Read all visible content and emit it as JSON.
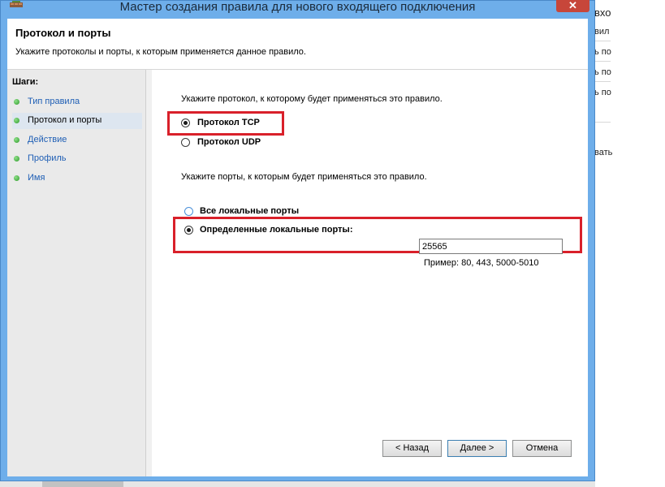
{
  "window": {
    "title": "Мастер создания правила для нового входящего подключения",
    "close_glyph": "✕"
  },
  "header": {
    "title": "Протокол и порты",
    "description": "Укажите протоколы и порты, к которым применяется данное правило."
  },
  "steps": {
    "title": "Шаги:",
    "items": [
      {
        "label": "Тип правила"
      },
      {
        "label": "Протокол и порты"
      },
      {
        "label": "Действие"
      },
      {
        "label": "Профиль"
      },
      {
        "label": "Имя"
      }
    ]
  },
  "protocol": {
    "prompt": "Укажите протокол, к которому будет применяться это правило.",
    "tcp_label": "Протокол TCP",
    "udp_label": "Протокол UDP",
    "selected": "TCP"
  },
  "ports": {
    "prompt": "Укажите порты, к которым будет применяться это правило.",
    "all_label": "Все локальные порты",
    "specific_label": "Определенные локальные порты:",
    "value": "25565",
    "example": "Пример: 80, 443, 5000-5010",
    "selected": "specific"
  },
  "buttons": {
    "back": "< Назад",
    "next": "Далее >",
    "cancel": "Отмена"
  },
  "background_window": {
    "items": [
      "вхо",
      "вил",
      "ь по",
      "ь по",
      "ь по",
      "вать"
    ]
  },
  "colors": {
    "title_bar": "#6eaeea",
    "close_button": "#c7463a",
    "highlight": "#d9202a",
    "step_link": "#1f5fb5"
  }
}
